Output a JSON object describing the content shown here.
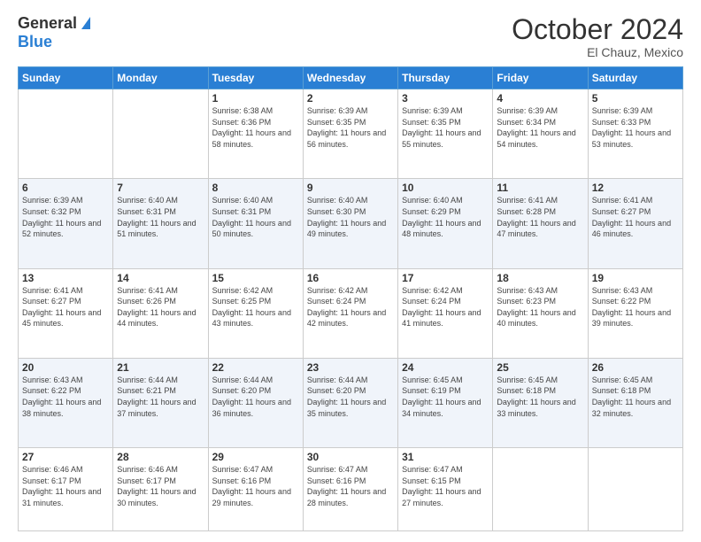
{
  "header": {
    "logo_general": "General",
    "logo_blue": "Blue",
    "month": "October 2024",
    "location": "El Chauz, Mexico"
  },
  "weekdays": [
    "Sunday",
    "Monday",
    "Tuesday",
    "Wednesday",
    "Thursday",
    "Friday",
    "Saturday"
  ],
  "weeks": [
    [
      {
        "day": "",
        "info": ""
      },
      {
        "day": "",
        "info": ""
      },
      {
        "day": "1",
        "info": "Sunrise: 6:38 AM\nSunset: 6:36 PM\nDaylight: 11 hours and 58 minutes."
      },
      {
        "day": "2",
        "info": "Sunrise: 6:39 AM\nSunset: 6:35 PM\nDaylight: 11 hours and 56 minutes."
      },
      {
        "day": "3",
        "info": "Sunrise: 6:39 AM\nSunset: 6:35 PM\nDaylight: 11 hours and 55 minutes."
      },
      {
        "day": "4",
        "info": "Sunrise: 6:39 AM\nSunset: 6:34 PM\nDaylight: 11 hours and 54 minutes."
      },
      {
        "day": "5",
        "info": "Sunrise: 6:39 AM\nSunset: 6:33 PM\nDaylight: 11 hours and 53 minutes."
      }
    ],
    [
      {
        "day": "6",
        "info": "Sunrise: 6:39 AM\nSunset: 6:32 PM\nDaylight: 11 hours and 52 minutes."
      },
      {
        "day": "7",
        "info": "Sunrise: 6:40 AM\nSunset: 6:31 PM\nDaylight: 11 hours and 51 minutes."
      },
      {
        "day": "8",
        "info": "Sunrise: 6:40 AM\nSunset: 6:31 PM\nDaylight: 11 hours and 50 minutes."
      },
      {
        "day": "9",
        "info": "Sunrise: 6:40 AM\nSunset: 6:30 PM\nDaylight: 11 hours and 49 minutes."
      },
      {
        "day": "10",
        "info": "Sunrise: 6:40 AM\nSunset: 6:29 PM\nDaylight: 11 hours and 48 minutes."
      },
      {
        "day": "11",
        "info": "Sunrise: 6:41 AM\nSunset: 6:28 PM\nDaylight: 11 hours and 47 minutes."
      },
      {
        "day": "12",
        "info": "Sunrise: 6:41 AM\nSunset: 6:27 PM\nDaylight: 11 hours and 46 minutes."
      }
    ],
    [
      {
        "day": "13",
        "info": "Sunrise: 6:41 AM\nSunset: 6:27 PM\nDaylight: 11 hours and 45 minutes."
      },
      {
        "day": "14",
        "info": "Sunrise: 6:41 AM\nSunset: 6:26 PM\nDaylight: 11 hours and 44 minutes."
      },
      {
        "day": "15",
        "info": "Sunrise: 6:42 AM\nSunset: 6:25 PM\nDaylight: 11 hours and 43 minutes."
      },
      {
        "day": "16",
        "info": "Sunrise: 6:42 AM\nSunset: 6:24 PM\nDaylight: 11 hours and 42 minutes."
      },
      {
        "day": "17",
        "info": "Sunrise: 6:42 AM\nSunset: 6:24 PM\nDaylight: 11 hours and 41 minutes."
      },
      {
        "day": "18",
        "info": "Sunrise: 6:43 AM\nSunset: 6:23 PM\nDaylight: 11 hours and 40 minutes."
      },
      {
        "day": "19",
        "info": "Sunrise: 6:43 AM\nSunset: 6:22 PM\nDaylight: 11 hours and 39 minutes."
      }
    ],
    [
      {
        "day": "20",
        "info": "Sunrise: 6:43 AM\nSunset: 6:22 PM\nDaylight: 11 hours and 38 minutes."
      },
      {
        "day": "21",
        "info": "Sunrise: 6:44 AM\nSunset: 6:21 PM\nDaylight: 11 hours and 37 minutes."
      },
      {
        "day": "22",
        "info": "Sunrise: 6:44 AM\nSunset: 6:20 PM\nDaylight: 11 hours and 36 minutes."
      },
      {
        "day": "23",
        "info": "Sunrise: 6:44 AM\nSunset: 6:20 PM\nDaylight: 11 hours and 35 minutes."
      },
      {
        "day": "24",
        "info": "Sunrise: 6:45 AM\nSunset: 6:19 PM\nDaylight: 11 hours and 34 minutes."
      },
      {
        "day": "25",
        "info": "Sunrise: 6:45 AM\nSunset: 6:18 PM\nDaylight: 11 hours and 33 minutes."
      },
      {
        "day": "26",
        "info": "Sunrise: 6:45 AM\nSunset: 6:18 PM\nDaylight: 11 hours and 32 minutes."
      }
    ],
    [
      {
        "day": "27",
        "info": "Sunrise: 6:46 AM\nSunset: 6:17 PM\nDaylight: 11 hours and 31 minutes."
      },
      {
        "day": "28",
        "info": "Sunrise: 6:46 AM\nSunset: 6:17 PM\nDaylight: 11 hours and 30 minutes."
      },
      {
        "day": "29",
        "info": "Sunrise: 6:47 AM\nSunset: 6:16 PM\nDaylight: 11 hours and 29 minutes."
      },
      {
        "day": "30",
        "info": "Sunrise: 6:47 AM\nSunset: 6:16 PM\nDaylight: 11 hours and 28 minutes."
      },
      {
        "day": "31",
        "info": "Sunrise: 6:47 AM\nSunset: 6:15 PM\nDaylight: 11 hours and 27 minutes."
      },
      {
        "day": "",
        "info": ""
      },
      {
        "day": "",
        "info": ""
      }
    ]
  ]
}
